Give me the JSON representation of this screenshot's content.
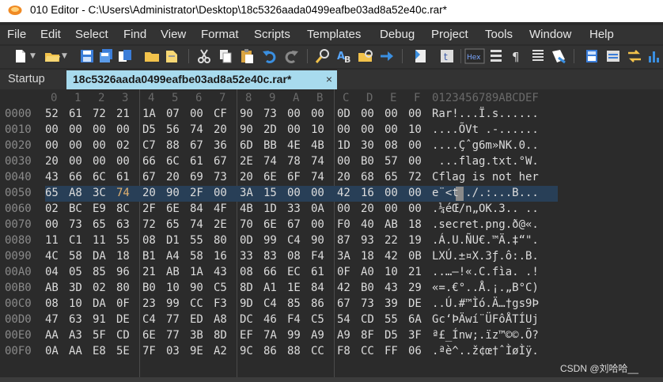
{
  "window": {
    "title": "010 Editor - C:\\Users\\Administrator\\Desktop\\18c5326aada0499eafbe03ad8a52e40c.rar*"
  },
  "menu": [
    "File",
    "Edit",
    "Select",
    "Find",
    "View",
    "Format",
    "Scripts",
    "Templates",
    "Debug",
    "Project",
    "Tools",
    "Window",
    "Help"
  ],
  "toolbar": {
    "icons": [
      "new-file-icon",
      "open-folder-icon",
      "save-icon",
      "save-all-icon",
      "copy-file-icon",
      "folder-icon",
      "open-icon",
      "cut-icon",
      "copy-icon",
      "paste-icon",
      "undo-icon",
      "redo-icon",
      "find-icon",
      "replace-icon",
      "find-in-files-icon",
      "goto-icon",
      "bookmark-icon",
      "text-mode-icon",
      "hex-mode-icon",
      "template-icon",
      "pilcrow-icon",
      "columns-icon",
      "highlight-icon",
      "calculator-icon",
      "base-converter-icon",
      "compare-icon",
      "histogram-icon"
    ],
    "hex_label": "Hex"
  },
  "tabs": {
    "startup": "Startup",
    "active": "18c5326aada0499eafbe03ad8a52e40c.rar*",
    "close": "×"
  },
  "hex": {
    "column_header": [
      "0",
      "1",
      "2",
      "3",
      "4",
      "5",
      "6",
      "7",
      "8",
      "9",
      "A",
      "B",
      "C",
      "D",
      "E",
      "F"
    ],
    "ascii_header": "0123456789ABCDEF",
    "rows": [
      {
        "addr": "0000",
        "bytes": [
          "52",
          "61",
          "72",
          "21",
          "1A",
          "07",
          "00",
          "CF",
          "90",
          "73",
          "00",
          "00",
          "0D",
          "00",
          "00",
          "00"
        ],
        "ascii": "Rar!...Ï.s......"
      },
      {
        "addr": "0010",
        "bytes": [
          "00",
          "00",
          "00",
          "00",
          "D5",
          "56",
          "74",
          "20",
          "90",
          "2D",
          "00",
          "10",
          "00",
          "00",
          "00",
          "10"
        ],
        "ascii": "....ÕVt .-......"
      },
      {
        "addr": "0020",
        "bytes": [
          "00",
          "00",
          "00",
          "02",
          "C7",
          "88",
          "67",
          "36",
          "6D",
          "BB",
          "4E",
          "4B",
          "1D",
          "30",
          "08",
          "00"
        ],
        "ascii": "....Çˆg6m»NK.0.."
      },
      {
        "addr": "0030",
        "bytes": [
          "20",
          "00",
          "00",
          "00",
          "66",
          "6C",
          "61",
          "67",
          "2E",
          "74",
          "78",
          "74",
          "00",
          "B0",
          "57",
          "00"
        ],
        "ascii": " ...flag.txt.°W."
      },
      {
        "addr": "0040",
        "bytes": [
          "43",
          "66",
          "6C",
          "61",
          "67",
          "20",
          "69",
          "73",
          "20",
          "6E",
          "6F",
          "74",
          "20",
          "68",
          "65",
          "72"
        ],
        "ascii": "Cflag is not her"
      },
      {
        "addr": "0050",
        "bytes": [
          "65",
          "A8",
          "3C",
          "74",
          "20",
          "90",
          "2F",
          "00",
          "3A",
          "15",
          "00",
          "00",
          "42",
          "16",
          "00",
          "00"
        ],
        "ascii": "e¨<t ./.:...B..."
      },
      {
        "addr": "0060",
        "bytes": [
          "02",
          "BC",
          "E9",
          "8C",
          "2F",
          "6E",
          "84",
          "4F",
          "4B",
          "1D",
          "33",
          "0A",
          "00",
          "20",
          "00",
          "00"
        ],
        "ascii": ".¼éŒ/n„OK.3.. .."
      },
      {
        "addr": "0070",
        "bytes": [
          "00",
          "73",
          "65",
          "63",
          "72",
          "65",
          "74",
          "2E",
          "70",
          "6E",
          "67",
          "00",
          "F0",
          "40",
          "AB",
          "18"
        ],
        "ascii": ".secret.png.ð@«."
      },
      {
        "addr": "0080",
        "bytes": [
          "11",
          "C1",
          "11",
          "55",
          "08",
          "D1",
          "55",
          "80",
          "0D",
          "99",
          "C4",
          "90",
          "87",
          "93",
          "22",
          "19"
        ],
        "ascii": ".Á.U.ÑU€.™Ä.‡“\"."
      },
      {
        "addr": "0090",
        "bytes": [
          "4C",
          "58",
          "DA",
          "18",
          "B1",
          "A4",
          "58",
          "16",
          "33",
          "83",
          "08",
          "F4",
          "3A",
          "18",
          "42",
          "0B"
        ],
        "ascii": "LXÚ.±¤X.3ƒ.ô:.B."
      },
      {
        "addr": "00A0",
        "bytes": [
          "04",
          "05",
          "85",
          "96",
          "21",
          "AB",
          "1A",
          "43",
          "08",
          "66",
          "EC",
          "61",
          "0F",
          "A0",
          "10",
          "21"
        ],
        "ascii": "..…–!«.C.fìa. .!"
      },
      {
        "addr": "00B0",
        "bytes": [
          "AB",
          "3D",
          "02",
          "80",
          "B0",
          "10",
          "90",
          "C5",
          "8D",
          "A1",
          "1E",
          "84",
          "42",
          "B0",
          "43",
          "29"
        ],
        "ascii": "«=.€°..Å.¡.„B°C)"
      },
      {
        "addr": "00C0",
        "bytes": [
          "08",
          "10",
          "DA",
          "0F",
          "23",
          "99",
          "CC",
          "F3",
          "9D",
          "C4",
          "85",
          "86",
          "67",
          "73",
          "39",
          "DE"
        ],
        "ascii": "..Ú.#™Ìó.Ä…†gs9Þ"
      },
      {
        "addr": "00D0",
        "bytes": [
          "47",
          "63",
          "91",
          "DE",
          "C4",
          "77",
          "ED",
          "A8",
          "DC",
          "46",
          "F4",
          "C5",
          "54",
          "CD",
          "55",
          "6A"
        ],
        "ascii": "Gc‘ÞÄwí¨ÜFôÅTÍUj"
      },
      {
        "addr": "00E0",
        "bytes": [
          "AA",
          "A3",
          "5F",
          "CD",
          "6E",
          "77",
          "3B",
          "8D",
          "EF",
          "7A",
          "99",
          "A9",
          "A9",
          "8F",
          "D5",
          "3F"
        ],
        "ascii": "ª£_Ínw;.ïz™©©.Õ?"
      },
      {
        "addr": "00F0",
        "bytes": [
          "0A",
          "AA",
          "E8",
          "5E",
          "7F",
          "03",
          "9E",
          "A2",
          "9C",
          "86",
          "88",
          "CC",
          "F8",
          "CC",
          "FF",
          "06"
        ],
        "ascii": ".ªè^..ž¢œ†ˆÌøÌÿ."
      }
    ],
    "highlighted_row": 5,
    "cursor_col": 3
  },
  "watermark": "CSDN @刘哈哈__"
}
